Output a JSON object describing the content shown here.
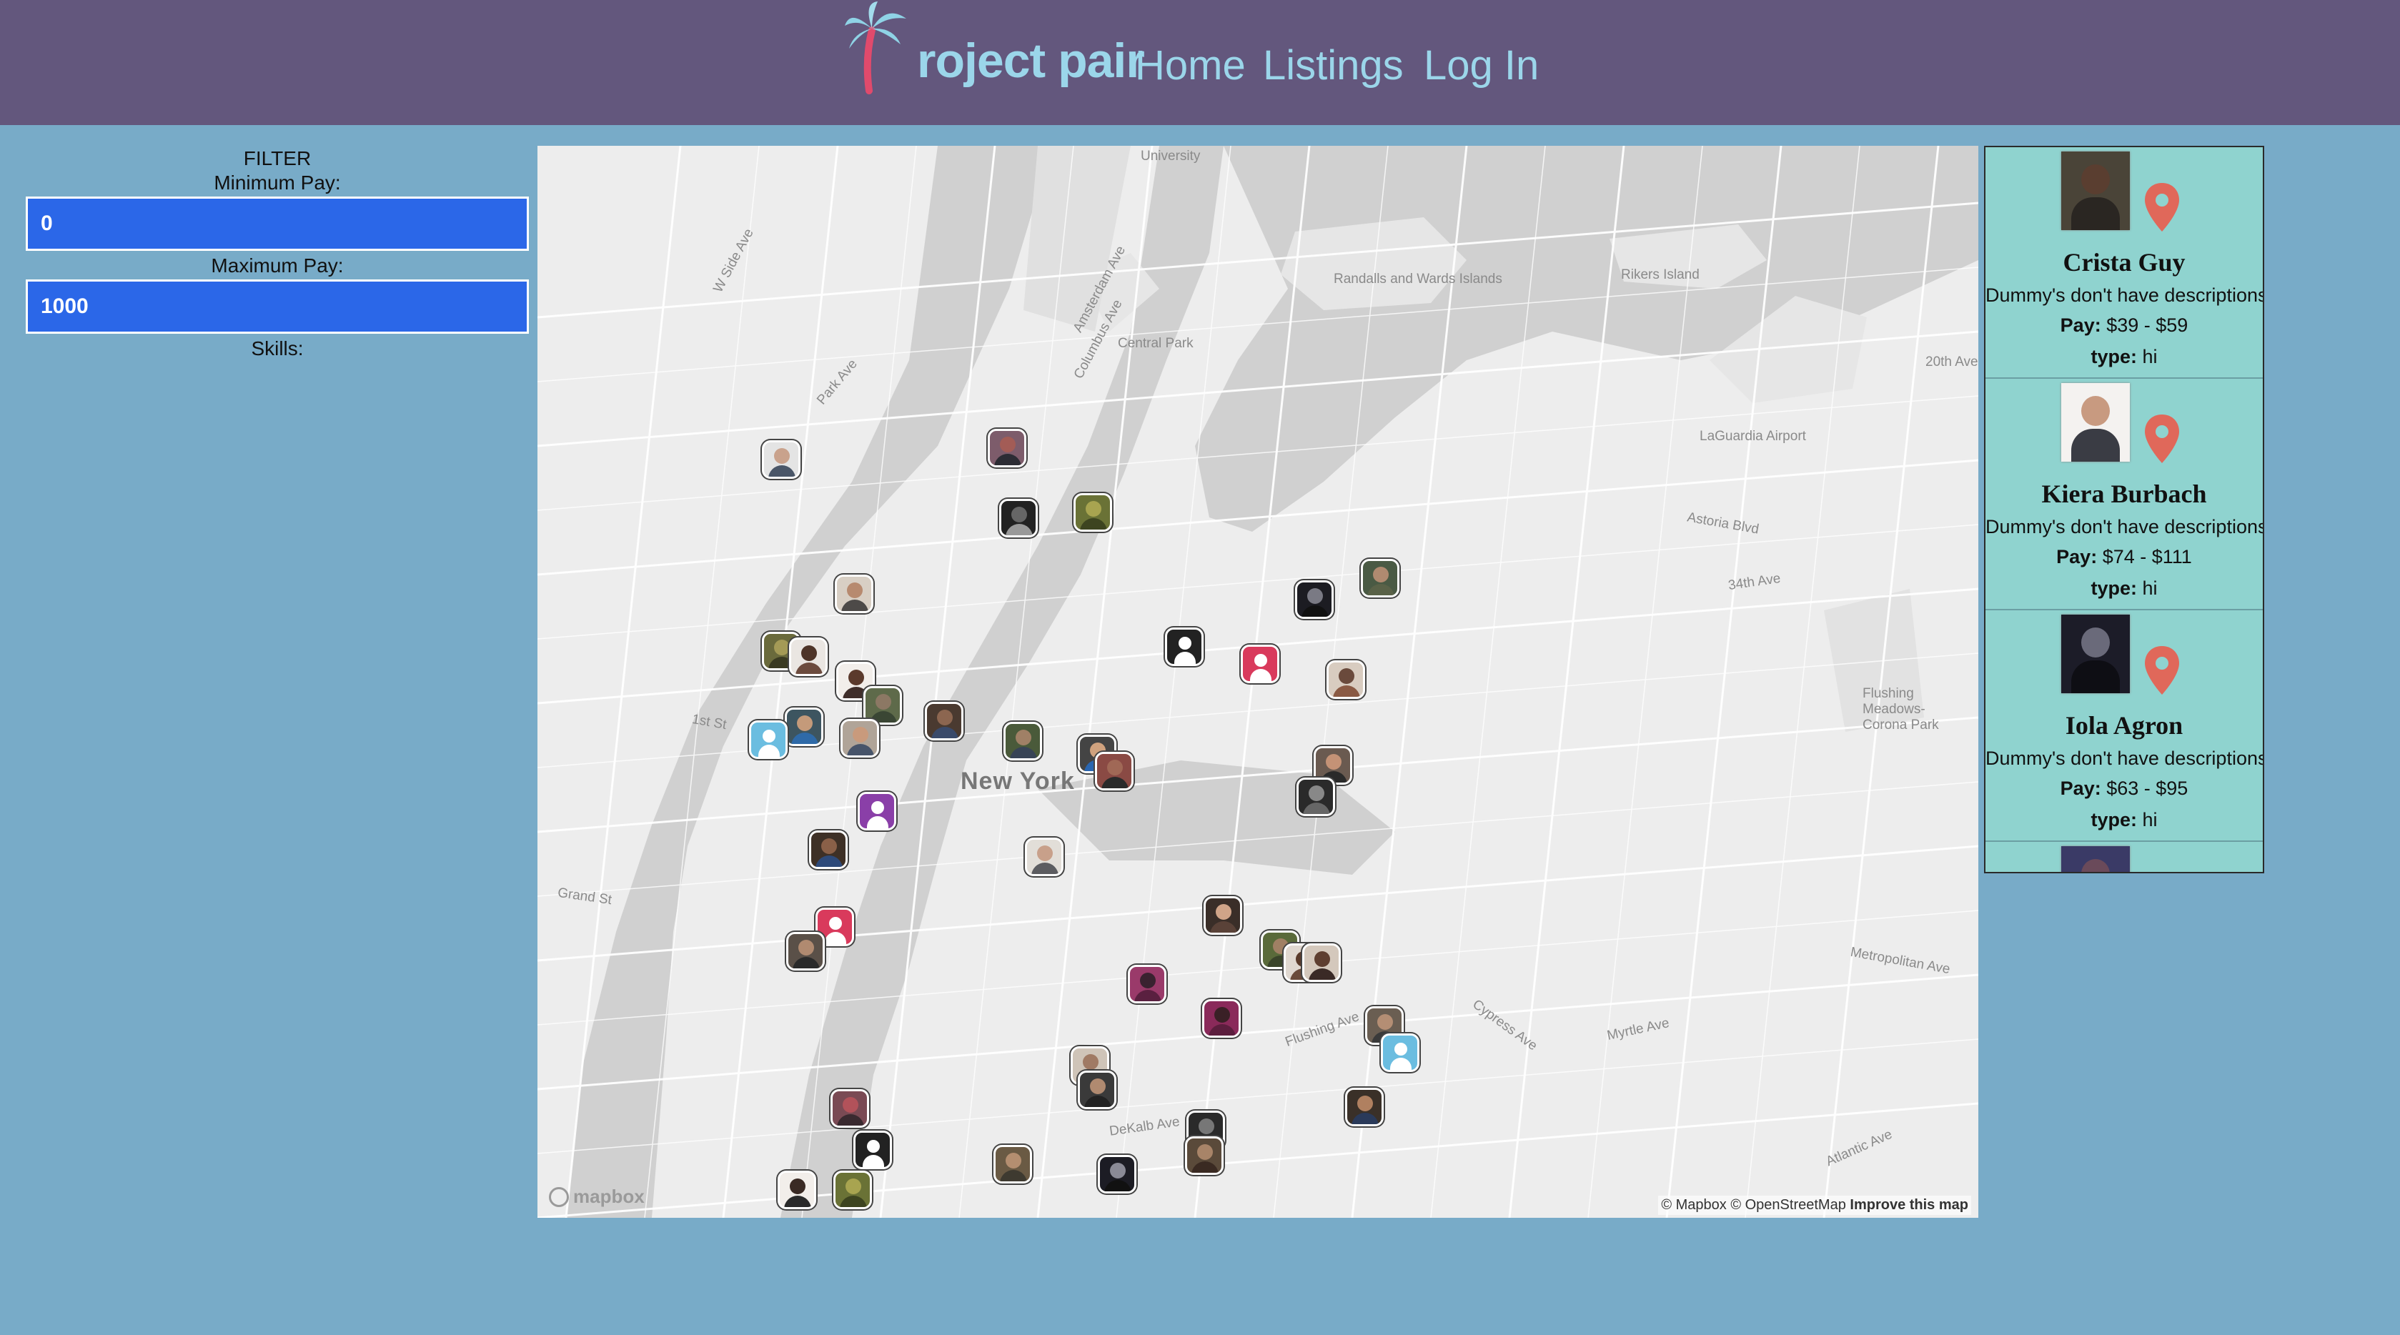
{
  "header": {
    "logo_text": "roject pair",
    "nav": {
      "home": "Home",
      "listings": "Listings",
      "login": "Log In"
    }
  },
  "filter": {
    "title": "FILTER",
    "min_label": "Minimum Pay:",
    "min_value": "0",
    "max_label": "Maximum Pay:",
    "max_value": "1000",
    "skills_label": "Skills:"
  },
  "map": {
    "labels": {
      "new_york": "New York",
      "randalls": "Randalls and Wards Islands",
      "rikers": "Rikers Island",
      "laguardia": "LaGuardia Airport",
      "central_park": "Central Park",
      "flushing": "Flushing Meadows-Corona Park",
      "astoria": "Astoria Blvd",
      "ave34": "34th Ave",
      "metropolitan": "Metropolitan Ave",
      "myrtle": "Myrtle Ave",
      "atlantic": "Atlantic Ave",
      "flushing_ave": "Flushing Ave",
      "cypress": "Cypress Ave",
      "dekalb": "DeKalb Ave",
      "grand": "Grand St",
      "ave20": "20th Ave",
      "w_side": "W Side Ave",
      "park_ave": "Park Ave",
      "columbus": "Columbus Ave",
      "amsterdam": "Amsterdam Ave",
      "university": "University",
      "first_st": "1st St"
    },
    "logo": "mapbox",
    "attribution": "© Mapbox © OpenStreetMap",
    "improve": "Improve this map"
  },
  "listings": [
    {
      "name": "Crista Guy",
      "desc": "Dummy's don't have descriptions",
      "pay_label": "Pay:",
      "pay": "$39 - $59",
      "type_label": "type:",
      "type": "hi"
    },
    {
      "name": "Kiera Burbach",
      "desc": "Dummy's don't have descriptions",
      "pay_label": "Pay:",
      "pay": "$74 - $111",
      "type_label": "type:",
      "type": "hi"
    },
    {
      "name": "Iola Agron",
      "desc": "Dummy's don't have descriptions",
      "pay_label": "Pay:",
      "pay": "$63 - $95",
      "type_label": "type:",
      "type": "hi"
    }
  ],
  "colors": {
    "header_bg": "#63577d",
    "nav_text": "#9bd6ea",
    "page_bg": "#78abc8",
    "input_bg": "#2b67e8",
    "listing_bg": "#8fd3cf",
    "pin": "#e0685a"
  }
}
